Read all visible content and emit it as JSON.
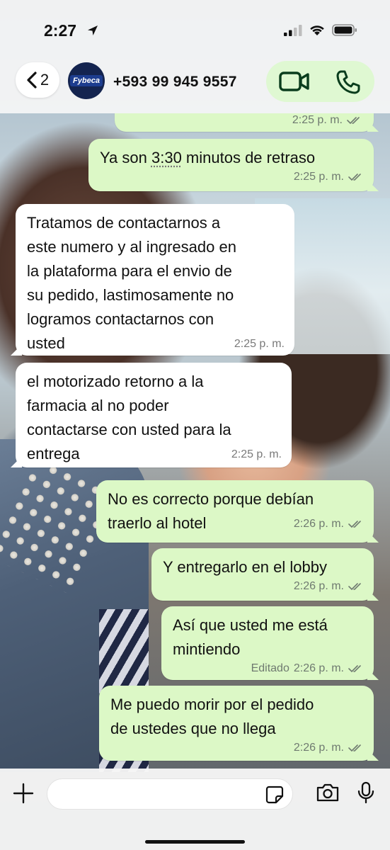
{
  "status_bar": {
    "time": "2:27"
  },
  "header": {
    "back_count": "2",
    "avatar_logo": "Fybeca",
    "contact": "+593 99 945 9557"
  },
  "messages": [
    {
      "dir": "out",
      "text": "",
      "time": "2:25 p. m.",
      "edited": ""
    },
    {
      "dir": "out",
      "text_before": "Ya son ",
      "text_underlined": "3:30",
      "text_after": " minutos de retraso",
      "time": "2:25 p. m."
    },
    {
      "dir": "in",
      "text": "Tratamos de contactarnos a\neste numero y al ingresado en\nla plataforma para el envio de\nsu pedido, lastimosamente no\nlogramos contactarnos con\nusted",
      "time": "2:25 p. m."
    },
    {
      "dir": "in",
      "text": "el motorizado retorno a la\nfarmacia al no poder\ncontactarse con usted para la\nentrega",
      "time": "2:25 p. m."
    },
    {
      "dir": "out",
      "text": "No es correcto porque debían\ntraerlo al hotel",
      "time": "2:26 p. m."
    },
    {
      "dir": "out",
      "text": "Y entregarlo en el lobby",
      "time": "2:26 p. m."
    },
    {
      "dir": "out",
      "text": "Así que usted me está\nmintiendo",
      "edited": "Editado",
      "time": "2:26 p. m."
    },
    {
      "dir": "out",
      "text": "Me puedo morir por el pedido\nde ustedes que no llega",
      "time": "2:26 p. m."
    }
  ],
  "input": {
    "placeholder": ""
  },
  "colors": {
    "outgoing_bubble": "#dcf8c6",
    "incoming_bubble": "#ffffff",
    "call_pill": "#dff8d2",
    "icon_green": "#0a3d1d"
  },
  "icons": [
    "location-arrow-icon",
    "signal-icon",
    "wifi-icon",
    "battery-icon",
    "chevron-left-icon",
    "video-call-icon",
    "phone-icon",
    "read-ticks-icon",
    "plus-icon",
    "sticker-icon",
    "camera-icon",
    "microphone-icon"
  ]
}
